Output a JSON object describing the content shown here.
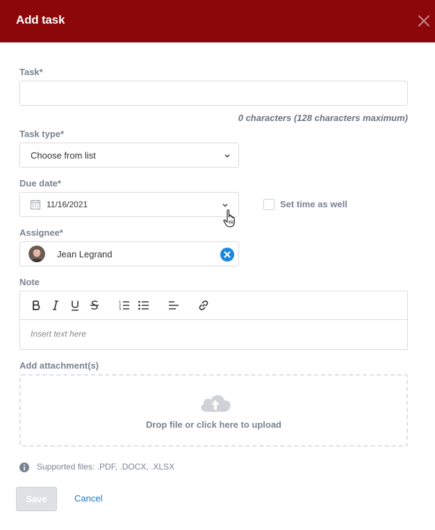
{
  "header": {
    "title": "Add task",
    "close_icon": "close-icon",
    "background": "#8b0709"
  },
  "task": {
    "label": "Task*",
    "value": "",
    "placeholder": "",
    "char_count": "0 characters (128 characters maximum)"
  },
  "task_type": {
    "label": "Task type*",
    "selected": "Choose from list"
  },
  "due_date": {
    "label": "Due date*",
    "value": "11/16/2021",
    "set_time_label": "Set time as well",
    "set_time_checked": false
  },
  "assignee": {
    "label": "Assignee*",
    "name": "Jean Legrand"
  },
  "note": {
    "label": "Note",
    "placeholder": "Insert text here",
    "toolbar": [
      "bold",
      "italic",
      "underline",
      "strikethrough",
      "ordered-list",
      "bullet-list",
      "align-left",
      "link"
    ]
  },
  "attachments": {
    "label": "Add attachment(s)",
    "drop_text": "Drop file or click here to upload",
    "supported": "Supported files: .PDF, .DOCX, .XLSX"
  },
  "actions": {
    "save_label": "Save",
    "cancel_label": "Cancel"
  },
  "colors": {
    "accent": "#1a7ac7",
    "clear": "#1a87e0",
    "save_disabled": "#dfe1e5"
  }
}
